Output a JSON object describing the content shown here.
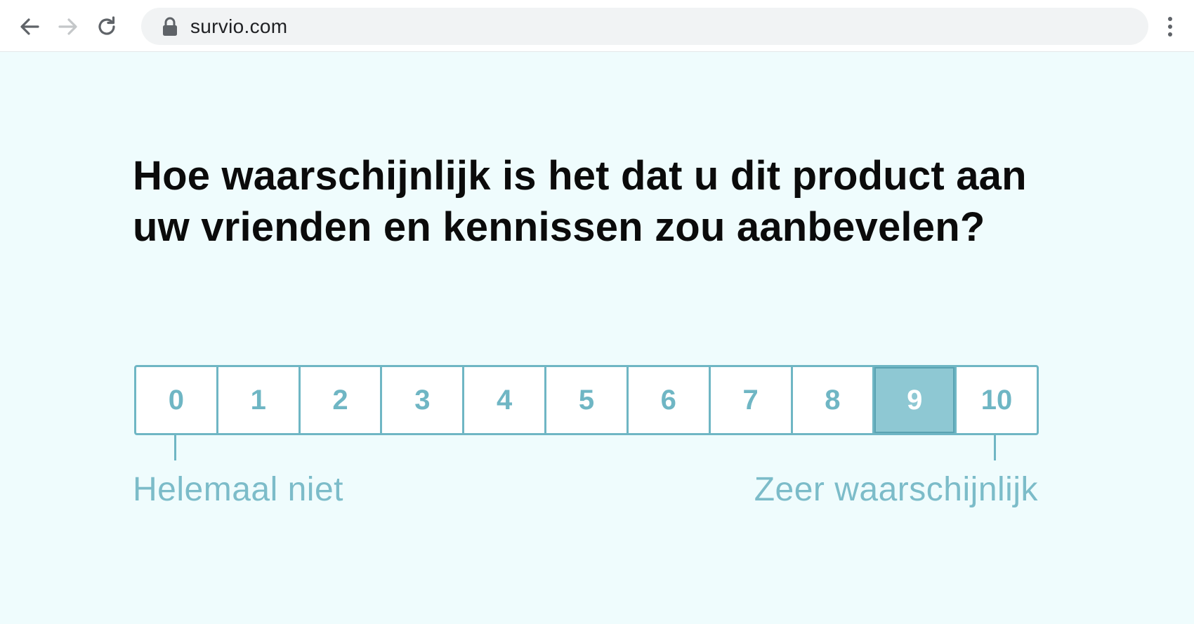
{
  "browser": {
    "url": "survio.com",
    "icons": {
      "back": "arrow-left-icon",
      "forward": "arrow-right-icon",
      "reload": "reload-icon",
      "lock": "lock-icon",
      "menu": "kebab-menu-icon"
    }
  },
  "survey": {
    "question": "Hoe waarschijnlijk is het dat u dit product aan uw vrienden en kennissen zou aanbevelen?",
    "scale": {
      "options": [
        "0",
        "1",
        "2",
        "3",
        "4",
        "5",
        "6",
        "7",
        "8",
        "9",
        "10"
      ],
      "selected": "9",
      "low_label": "Helemaal niet",
      "high_label": "Zeer waarschijnlijk"
    }
  },
  "colors": {
    "page_background": "#effcfd",
    "accent": "#6fb6c4",
    "selected_fill": "#8ec8d3",
    "question_text": "#0b0b0b"
  }
}
